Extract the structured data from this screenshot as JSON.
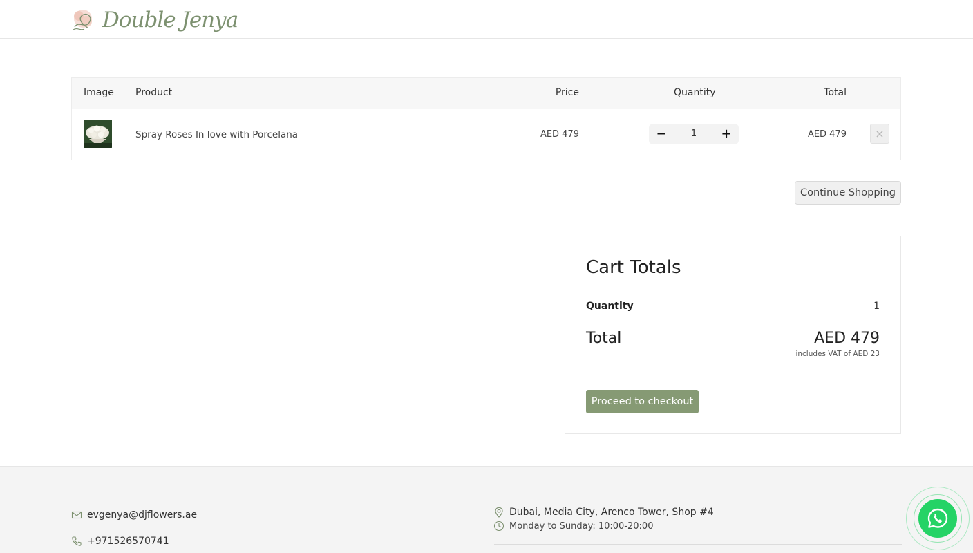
{
  "header": {
    "logo_text": "Double Jenya"
  },
  "cart": {
    "columns": {
      "image": "Image",
      "product": "Product",
      "price": "Price",
      "quantity": "Quantity",
      "total": "Total"
    },
    "items": [
      {
        "name": "Spray Roses In love with Porcelana",
        "price": "AED 479",
        "quantity": "1",
        "total": "AED 479",
        "minus_symbol": "−",
        "plus_symbol": "+",
        "remove_symbol": "×"
      }
    ],
    "continue_label": "Continue Shopping"
  },
  "totals": {
    "title": "Cart Totals",
    "quantity_label": "Quantity",
    "quantity_value": "1",
    "total_label": "Total",
    "total_value": "AED 479",
    "vat_note": "includes VAT of AED 23",
    "checkout_label": "Proceed to checkout"
  },
  "footer": {
    "email": "evgenya@djflowers.ae",
    "phone": "+971526570741",
    "address": "Dubai, Media City, Arenco Tower, Shop #4",
    "hours": "Monday to Sunday: 10:00-20:00"
  },
  "colors": {
    "accent": "#869a74",
    "logo": "#7d9170",
    "whatsapp": "#25d366",
    "footer_bg": "#f4f4f4",
    "table_header_bg": "#f7f7f7"
  },
  "icons": {
    "logo": "flower-logo-icon",
    "email": "envelope-icon",
    "phone": "phone-icon",
    "location": "map-pin-icon",
    "hours": "clock-icon",
    "chat": "whatsapp-icon"
  }
}
